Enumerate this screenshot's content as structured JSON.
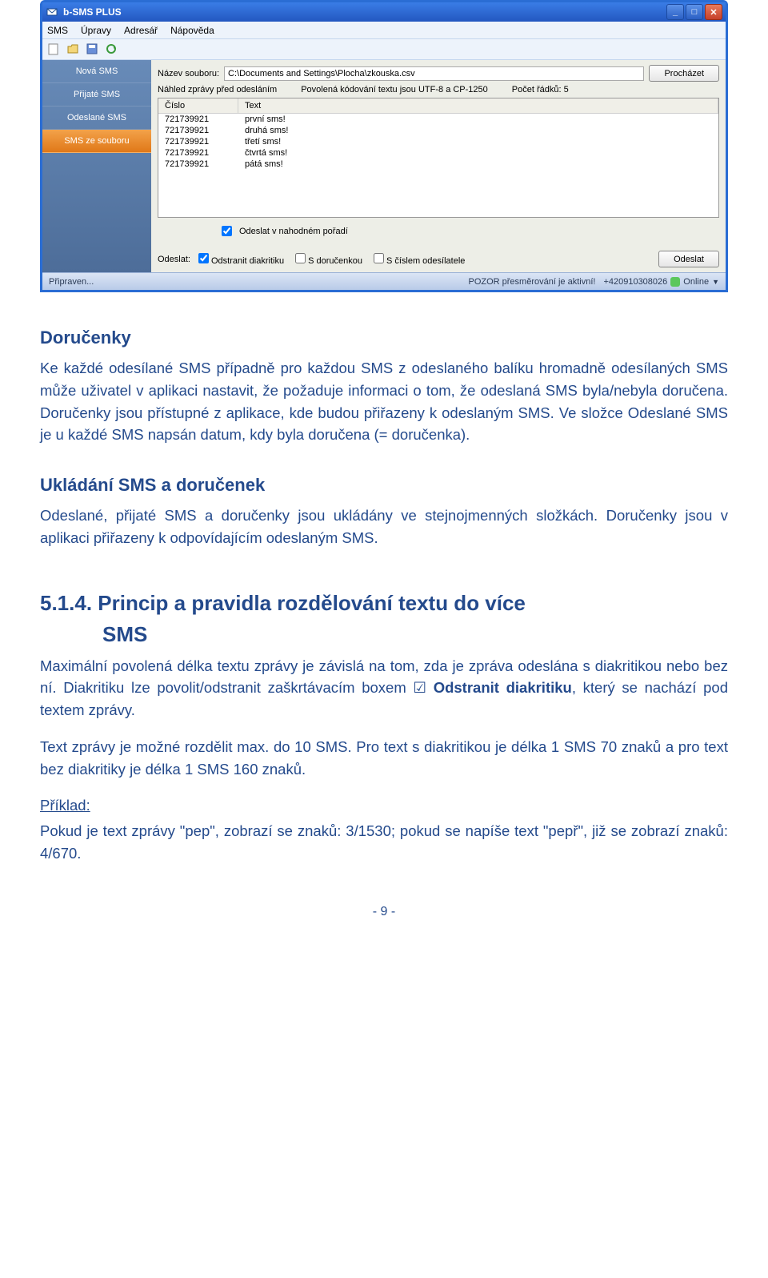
{
  "app": {
    "title": "b-SMS PLUS",
    "menu": [
      "SMS",
      "Úpravy",
      "Adresář",
      "Nápověda"
    ],
    "sidebar": {
      "items": [
        {
          "label": "Nová SMS"
        },
        {
          "label": "Přijaté SMS"
        },
        {
          "label": "Odeslané SMS"
        },
        {
          "label": "SMS ze souboru"
        }
      ]
    },
    "content": {
      "file_label": "Název souboru:",
      "file_path": "C:\\Documents and Settings\\Plocha\\zkouska.csv",
      "browse_btn": "Procházet",
      "preview_label": "Náhled zprávy před odesláním",
      "encoding_label": "Povolená kódování textu jsou UTF-8 a CP-1250",
      "row_count_label": "Počet řádků: 5",
      "col_num": "Číslo",
      "col_text": "Text",
      "rows": [
        {
          "num": "721739921",
          "text": "první sms!"
        },
        {
          "num": "721739921",
          "text": "druhá sms!"
        },
        {
          "num": "721739921",
          "text": "třetí sms!"
        },
        {
          "num": "721739921",
          "text": "čtvrtá sms!"
        },
        {
          "num": "721739921",
          "text": "pátá sms!"
        }
      ],
      "random_order": "Odeslat v nahodném pořadí",
      "send_label": "Odeslat:",
      "opt_diacritics": "Odstranit diakritiku",
      "opt_receipt": "S doručenkou",
      "opt_sender_num": "S číslem odesílatele",
      "send_btn": "Odeslat"
    },
    "status": {
      "left": "Připraven...",
      "warn": "POZOR přesměrování je aktivní!",
      "phone": "+420910308026",
      "online": "Online"
    }
  },
  "doc": {
    "h2_dorucenky": "Doručenky",
    "p_dorucenky": "Ke každé odesílané SMS případně pro každou SMS z odeslaného balíku hromadně odesílaných SMS může uživatel v aplikaci nastavit, že požaduje informaci o tom, že odeslaná SMS byla/nebyla doručena. Doručenky jsou přístupné z aplikace, kde budou přiřazeny k odeslaným SMS. Ve složce Odeslané SMS je u každé SMS napsán datum, kdy byla doručena (= doručenka).",
    "h2_ukladani": "Ukládání SMS a doručenek",
    "p_ukladani": "Odeslané, přijaté SMS a doručenky jsou ukládány ve stejnojmenných složkách. Doručenky jsou v aplikaci přiřazeny k odpovídajícím odeslaným SMS.",
    "h3_num": "5.1.4.",
    "h3_line1": "Princip a pravidla rozdělování textu do více",
    "h3_line2": "SMS",
    "p_max_a": "Maximální povolená délka textu zprávy je závislá na tom, zda je zpráva odeslána s diakritikou nebo bez ní. Diakritiku lze povolit/odstranit zaškrtávacím boxem ☑ ",
    "p_max_bold": "Odstranit diakritiku",
    "p_max_b": ", který se nachází pod textem zprávy.",
    "p_split": "Text zprávy je možné rozdělit max. do 10 SMS.  Pro text s diakritikou je délka 1 SMS 70 znaků a pro text bez diakritiky je délka 1 SMS 160 znaků.",
    "example_label": "Příklad:",
    "p_example": "Pokud je text zprávy \"pep\", zobrazí se znaků: 3/1530; pokud se napíše text \"pepř\", již se zobrazí znaků: 4/670.",
    "page_num": "- 9 -"
  }
}
